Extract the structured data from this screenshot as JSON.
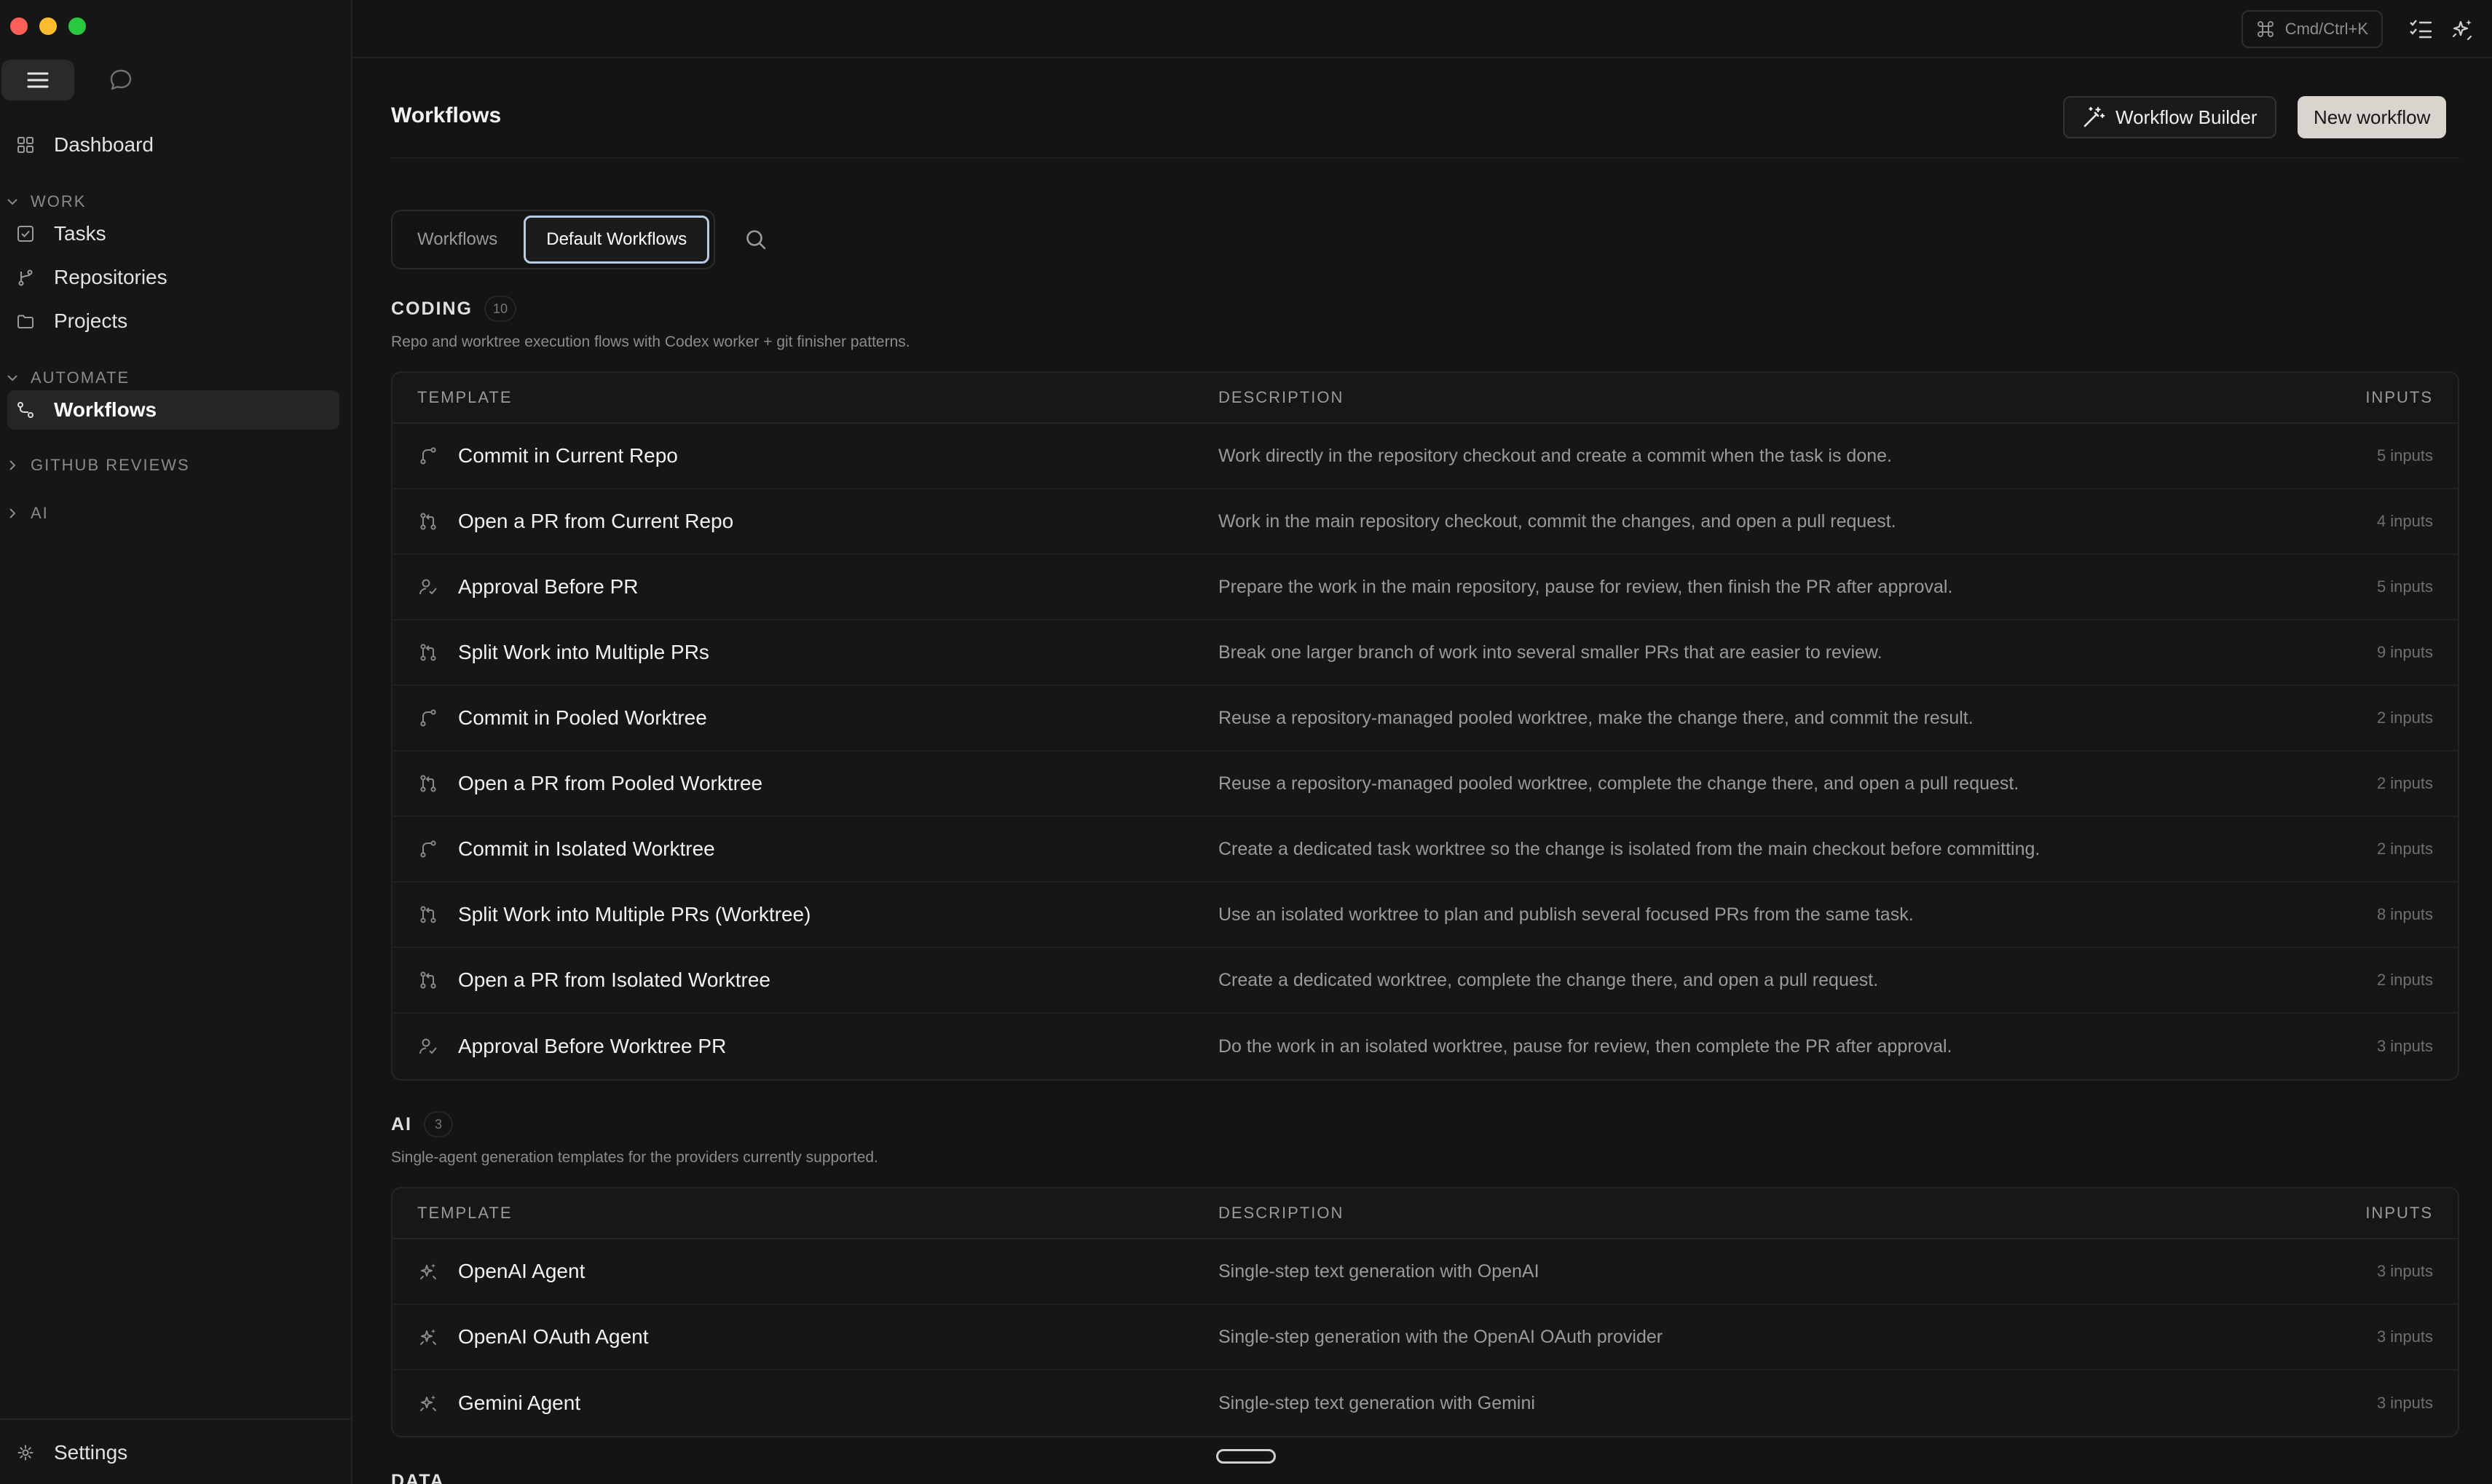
{
  "sidebar": {
    "dashboard": "Dashboard",
    "work_section": "WORK",
    "tasks": "Tasks",
    "repositories": "Repositories",
    "projects": "Projects",
    "automate_section": "AUTOMATE",
    "workflows": "Workflows",
    "github_reviews_section": "GITHUB REVIEWS",
    "ai_section": "AI",
    "settings": "Settings"
  },
  "topbar": {
    "cmdk_label": "Cmd/Ctrl+K"
  },
  "header": {
    "title": "Workflows",
    "builder_button": "Workflow Builder",
    "new_button": "New workflow"
  },
  "tabs": {
    "workflows": "Workflows",
    "default_workflows": "Default Workflows",
    "active": "Default Workflows"
  },
  "table_headers": {
    "template": "TEMPLATE",
    "description": "DESCRIPTION",
    "inputs": "INPUTS"
  },
  "coding": {
    "title": "CODING",
    "count": "10",
    "description": "Repo and worktree execution flows with Codex worker + git finisher patterns.",
    "rows": [
      {
        "icon": "git-commit-icon",
        "name": "Commit in Current Repo",
        "desc": "Work directly in the repository checkout and create a commit when the task is done.",
        "inputs": "5 inputs"
      },
      {
        "icon": "git-pull-request-icon",
        "name": "Open a PR from Current Repo",
        "desc": "Work in the main repository checkout, commit the changes, and open a pull request.",
        "inputs": "4 inputs"
      },
      {
        "icon": "user-check-icon",
        "name": "Approval Before PR",
        "desc": "Prepare the work in the main repository, pause for review, then finish the PR after approval.",
        "inputs": "5 inputs"
      },
      {
        "icon": "git-pull-request-icon",
        "name": "Split Work into Multiple PRs",
        "desc": "Break one larger branch of work into several smaller PRs that are easier to review.",
        "inputs": "9 inputs"
      },
      {
        "icon": "git-commit-icon",
        "name": "Commit in Pooled Worktree",
        "desc": "Reuse a repository-managed pooled worktree, make the change there, and commit the result.",
        "inputs": "2 inputs"
      },
      {
        "icon": "git-pull-request-icon",
        "name": "Open a PR from Pooled Worktree",
        "desc": "Reuse a repository-managed pooled worktree, complete the change there, and open a pull request.",
        "inputs": "2 inputs"
      },
      {
        "icon": "git-commit-icon",
        "name": "Commit in Isolated Worktree",
        "desc": "Create a dedicated task worktree so the change is isolated from the main checkout before committing.",
        "inputs": "2 inputs"
      },
      {
        "icon": "git-pull-request-icon",
        "name": "Split Work into Multiple PRs (Worktree)",
        "desc": "Use an isolated worktree to plan and publish several focused PRs from the same task.",
        "inputs": "8 inputs"
      },
      {
        "icon": "git-pull-request-icon",
        "name": "Open a PR from Isolated Worktree",
        "desc": "Create a dedicated worktree, complete the change there, and open a pull request.",
        "inputs": "2 inputs"
      },
      {
        "icon": "user-check-icon",
        "name": "Approval Before Worktree PR",
        "desc": "Do the work in an isolated worktree, pause for review, then complete the PR after approval.",
        "inputs": "3 inputs"
      }
    ]
  },
  "ai": {
    "title": "AI",
    "count": "3",
    "description": "Single-agent generation templates for the providers currently supported.",
    "rows": [
      {
        "icon": "sparkles-icon",
        "name": "OpenAI Agent",
        "desc": "Single-step text generation with OpenAI",
        "inputs": "3 inputs"
      },
      {
        "icon": "sparkles-icon",
        "name": "OpenAI OAuth Agent",
        "desc": "Single-step generation with the OpenAI OAuth provider",
        "inputs": "3 inputs"
      },
      {
        "icon": "sparkles-icon",
        "name": "Gemini Agent",
        "desc": "Single-step text generation with Gemini",
        "inputs": "3 inputs"
      }
    ]
  },
  "data_section_peek": "DATA",
  "colors": {
    "background": "#141414",
    "sidebar": "#161616",
    "accent_outline": "#b9cbe4",
    "primary_button": "#d9d4cd"
  }
}
